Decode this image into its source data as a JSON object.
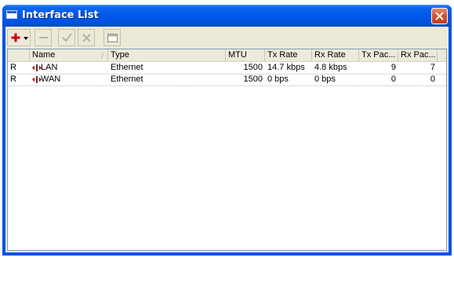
{
  "window": {
    "title": "Interface List"
  },
  "toolbar": {
    "buttons": [
      {
        "name": "add-button",
        "icon": "plus-icon"
      },
      {
        "name": "remove-button",
        "icon": "minus-icon"
      },
      {
        "name": "enable-button",
        "icon": "check-icon"
      },
      {
        "name": "disable-button",
        "icon": "x-icon"
      },
      {
        "name": "comment-button",
        "icon": "comment-icon"
      }
    ]
  },
  "table": {
    "columns": [
      "",
      "Name",
      "Type",
      "MTU",
      "Tx Rate",
      "Rx Rate",
      "Tx Pac...",
      "Rx Pac..."
    ],
    "sort_indicator": "/",
    "rows": [
      {
        "flag": "R",
        "name": "LAN",
        "type": "Ethernet",
        "mtu": "1500",
        "tx_rate": "14.7 kbps",
        "rx_rate": "4.8 kbps",
        "tx_packets": "9",
        "rx_packets": "7"
      },
      {
        "flag": "R",
        "name": "WAN",
        "type": "Ethernet",
        "mtu": "1500",
        "tx_rate": "0 bps",
        "rx_rate": "0 bps",
        "tx_packets": "0",
        "rx_packets": "0"
      }
    ]
  },
  "colors": {
    "titlebar": "#0054e3",
    "close": "#d5502c",
    "add_icon": "#cc0000",
    "interface_icon": "#c00000"
  }
}
